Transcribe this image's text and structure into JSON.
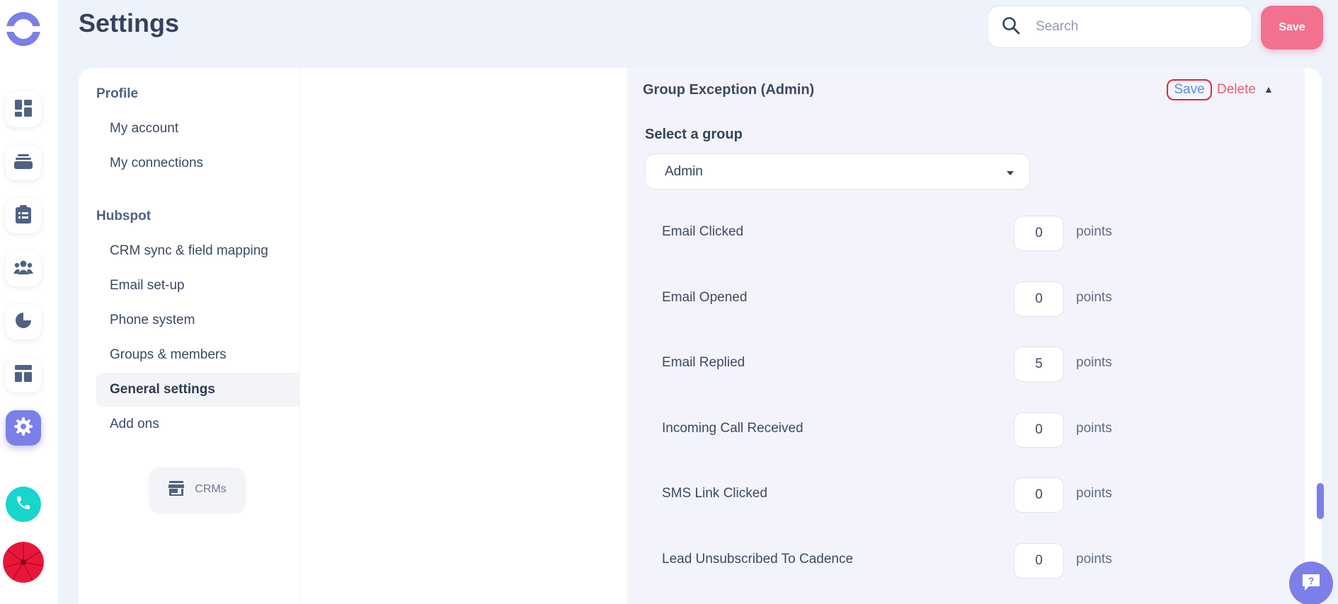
{
  "header": {
    "title": "Settings",
    "search_placeholder": "Search",
    "save_label": "Save"
  },
  "rail": {
    "items": [
      "dashboard-icon",
      "tasks-icon",
      "clipboard-icon",
      "people-icon",
      "pie-chart-icon",
      "layout-icon",
      "gear-icon"
    ],
    "active": "gear-icon",
    "accent": "#7c7fe8",
    "call_color": "#18d5cd"
  },
  "nav": {
    "profile_heading": "Profile",
    "profile_items": [
      "My account",
      "My connections"
    ],
    "hubspot_heading": "Hubspot",
    "hubspot_items": [
      "CRM sync & field mapping",
      "Email set-up",
      "Phone system",
      "Groups & members",
      "General settings",
      "Add ons"
    ],
    "active": "General settings",
    "crm_button": "CRMs"
  },
  "panel": {
    "title": "Group Exception (Admin)",
    "save_label": "Save",
    "delete_label": "Delete",
    "select_label": "Select a group",
    "selected_group": "Admin",
    "unit": "points",
    "rows": [
      {
        "label": "Email Clicked",
        "value": "0"
      },
      {
        "label": "Email Opened",
        "value": "0"
      },
      {
        "label": "Email Replied",
        "value": "5"
      },
      {
        "label": "Incoming Call Received",
        "value": "0"
      },
      {
        "label": "SMS Link Clicked",
        "value": "0"
      },
      {
        "label": "Lead Unsubscribed To Cadence",
        "value": "0"
      }
    ]
  },
  "help": {
    "icon": "help-chat-icon"
  }
}
